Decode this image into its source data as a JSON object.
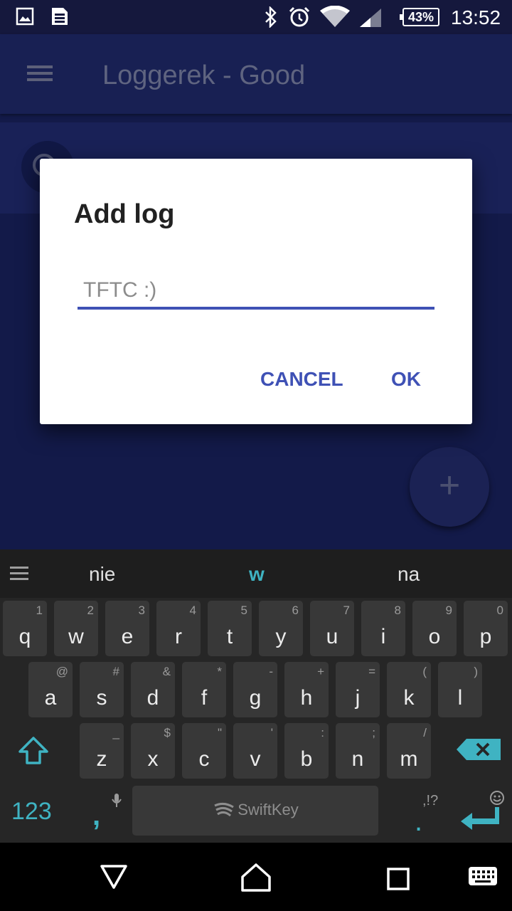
{
  "status_bar": {
    "icons": [
      "gallery-icon",
      "task-list-icon",
      "bluetooth-icon",
      "alarm-icon",
      "wifi-icon",
      "signal-icon"
    ],
    "battery": "43%",
    "time": "13:52"
  },
  "app": {
    "title": "Loggerek - Good",
    "menu_icon": "menu-icon",
    "fab_icon": "plus-icon",
    "fab_label": "+"
  },
  "dialog": {
    "title": "Add log",
    "input_placeholder": "TFTC :)",
    "input_value": "",
    "cancel_label": "CANCEL",
    "ok_label": "OK",
    "accent_color": "#3f51b5"
  },
  "keyboard": {
    "suggestions": [
      "nie",
      "w",
      "na"
    ],
    "rows": [
      [
        {
          "key": "q",
          "sec": "1"
        },
        {
          "key": "w",
          "sec": "2"
        },
        {
          "key": "e",
          "sec": "3"
        },
        {
          "key": "r",
          "sec": "4"
        },
        {
          "key": "t",
          "sec": "5"
        },
        {
          "key": "y",
          "sec": "6"
        },
        {
          "key": "u",
          "sec": "7"
        },
        {
          "key": "i",
          "sec": "8"
        },
        {
          "key": "o",
          "sec": "9"
        },
        {
          "key": "p",
          "sec": "0"
        }
      ],
      [
        {
          "key": "a",
          "sec": "@"
        },
        {
          "key": "s",
          "sec": "#"
        },
        {
          "key": "d",
          "sec": "&"
        },
        {
          "key": "f",
          "sec": "*"
        },
        {
          "key": "g",
          "sec": "-"
        },
        {
          "key": "h",
          "sec": "+"
        },
        {
          "key": "j",
          "sec": "="
        },
        {
          "key": "k",
          "sec": "("
        },
        {
          "key": "l",
          "sec": ")"
        }
      ],
      [
        {
          "key": "z",
          "sec": "_"
        },
        {
          "key": "x",
          "sec": "$"
        },
        {
          "key": "c",
          "sec": "\""
        },
        {
          "key": "v",
          "sec": "'"
        },
        {
          "key": "b",
          "sec": ":"
        },
        {
          "key": "n",
          "sec": ";"
        },
        {
          "key": "m",
          "sec": "/"
        }
      ]
    ],
    "numbers_label": "123",
    "comma_label": ",",
    "space_label": "SwiftKey",
    "punct_secondary": ",!?",
    "punct_primary": ".",
    "accent_color": "#3fb3c2"
  },
  "nav_bar": {
    "icons": [
      "back-icon",
      "home-icon",
      "recents-icon",
      "keyboard-switch-icon"
    ]
  }
}
